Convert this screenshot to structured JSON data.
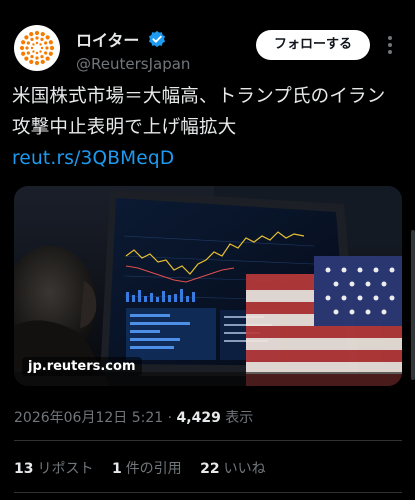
{
  "account": {
    "display_name": "ロイター",
    "handle": "@ReutersJapan",
    "verified": true,
    "avatar_icon": "reuters-dots-logo-icon",
    "verified_icon": "verified-badge-icon",
    "brand_color": "#f57c00"
  },
  "actions": {
    "follow_label": "フォローする",
    "more_icon": "more-vertical-icon"
  },
  "tweet": {
    "text": "米国株式市場＝大幅高、トランプ氏のイラン攻撃中止表明で上げ幅拡大 ",
    "link_text": "reut.rs/3QBMeqD"
  },
  "media": {
    "source_label": "jp.reuters.com",
    "description_icon": "trading-screen-with-us-flag-photo"
  },
  "meta": {
    "date": "2026年06月12日",
    "time": "5:21",
    "separator": "·",
    "views": "4,429",
    "views_label": "表示"
  },
  "stats": {
    "reposts": "13",
    "reposts_label": "リポスト",
    "quotes": "1",
    "quotes_label": "件の引用",
    "likes": "22",
    "likes_label": "いいね"
  },
  "colors": {
    "background": "#000000",
    "text": "#e7e9ea",
    "muted": "#71767b",
    "link": "#1d9bf0",
    "divider": "#2f3336"
  }
}
